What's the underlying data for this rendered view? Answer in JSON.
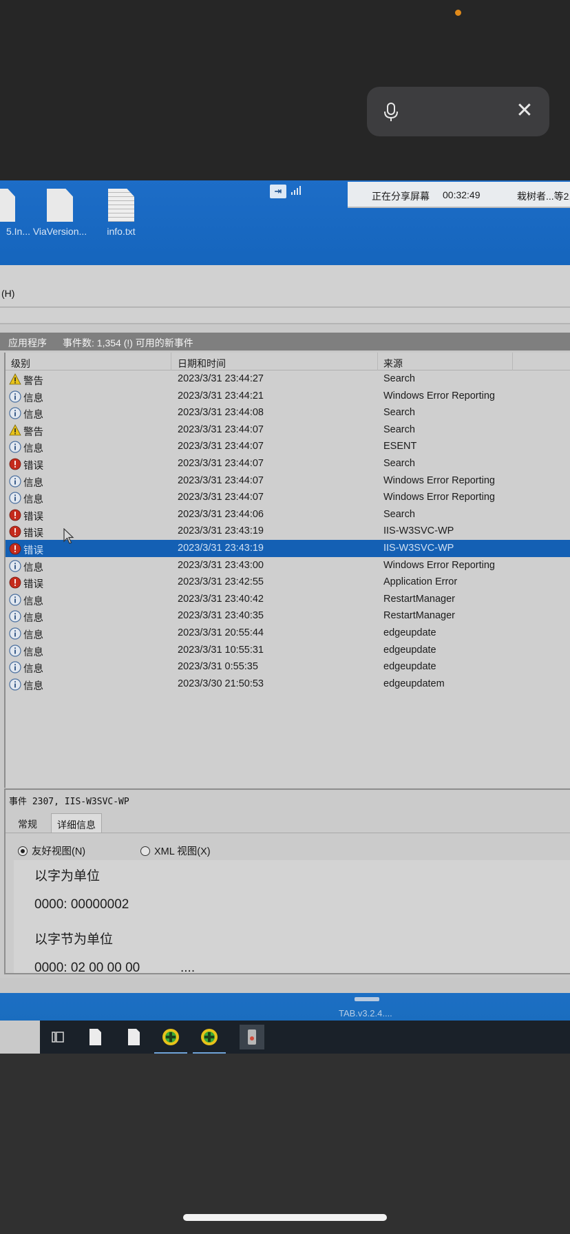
{
  "phone": {
    "mic_icon": "microphone-icon",
    "close_icon": "close-icon",
    "close_symbol": "✕"
  },
  "desktop": {
    "icons": [
      {
        "label": "5.In...",
        "icon": "file-icon"
      },
      {
        "label": "ViaVersion...",
        "icon": "file-icon"
      },
      {
        "label": "info.txt",
        "icon": "text-file-icon"
      }
    ],
    "share_status": "正在分享屏幕",
    "share_time": "00:32:49",
    "share_viewers": "栽树者...等2,",
    "pin_symbol": "⇥"
  },
  "menubar": {
    "help_label": "(H)"
  },
  "app": {
    "title": "应用程序",
    "summary": "事件数: 1,354 (!) 可用的新事件"
  },
  "grid": {
    "columns": [
      "级别",
      "日期和时间",
      "来源"
    ],
    "rows": [
      {
        "level": "警告",
        "type": "warning",
        "datetime": "2023/3/31 23:44:27",
        "source": "Search"
      },
      {
        "level": "信息",
        "type": "info",
        "datetime": "2023/3/31 23:44:21",
        "source": "Windows Error Reporting"
      },
      {
        "level": "信息",
        "type": "info",
        "datetime": "2023/3/31 23:44:08",
        "source": "Search"
      },
      {
        "level": "警告",
        "type": "warning",
        "datetime": "2023/3/31 23:44:07",
        "source": "Search"
      },
      {
        "level": "信息",
        "type": "info",
        "datetime": "2023/3/31 23:44:07",
        "source": "ESENT"
      },
      {
        "level": "错误",
        "type": "error",
        "datetime": "2023/3/31 23:44:07",
        "source": "Search"
      },
      {
        "level": "信息",
        "type": "info",
        "datetime": "2023/3/31 23:44:07",
        "source": "Windows Error Reporting"
      },
      {
        "level": "信息",
        "type": "info",
        "datetime": "2023/3/31 23:44:07",
        "source": "Windows Error Reporting"
      },
      {
        "level": "错误",
        "type": "error",
        "datetime": "2023/3/31 23:44:06",
        "source": "Search"
      },
      {
        "level": "错误",
        "type": "error",
        "datetime": "2023/3/31 23:43:19",
        "source": "IIS-W3SVC-WP"
      },
      {
        "level": "错误",
        "type": "error",
        "datetime": "2023/3/31 23:43:19",
        "source": "IIS-W3SVC-WP",
        "selected": true
      },
      {
        "level": "信息",
        "type": "info",
        "datetime": "2023/3/31 23:43:00",
        "source": "Windows Error Reporting"
      },
      {
        "level": "错误",
        "type": "error",
        "datetime": "2023/3/31 23:42:55",
        "source": "Application Error"
      },
      {
        "level": "信息",
        "type": "info",
        "datetime": "2023/3/31 23:40:42",
        "source": "RestartManager"
      },
      {
        "level": "信息",
        "type": "info",
        "datetime": "2023/3/31 23:40:35",
        "source": "RestartManager"
      },
      {
        "level": "信息",
        "type": "info",
        "datetime": "2023/3/31 20:55:44",
        "source": "edgeupdate"
      },
      {
        "level": "信息",
        "type": "info",
        "datetime": "2023/3/31 10:55:31",
        "source": "edgeupdate"
      },
      {
        "level": "信息",
        "type": "info",
        "datetime": "2023/3/31 0:55:35",
        "source": "edgeupdate"
      },
      {
        "level": "信息",
        "type": "info",
        "datetime": "2023/3/30 21:50:53",
        "source": "edgeupdatem"
      }
    ]
  },
  "detail": {
    "title": "事件 2307, IIS-W3SVC-WP",
    "tabs": [
      "常规",
      "详细信息"
    ],
    "active_tab": "详细信息",
    "view_options": [
      "友好视图(N)",
      "XML 视图(X)"
    ],
    "selected_view": "友好视图(N)",
    "lines": [
      "以字为单位",
      "0000: 00000002",
      "以字节为单位",
      "0000: 02 00 00 00",
      "...."
    ]
  },
  "bottom": {
    "tab_label": "TAB.v3.2.4...."
  },
  "taskbar": {
    "items": [
      "task-view-icon",
      "file-icon",
      "file-icon",
      "green-app-icon",
      "green-app-icon",
      "app-icon"
    ]
  },
  "colors": {
    "selection": "#1460b4",
    "desktop_blue": "#1565bd",
    "error_red": "#c42b1c",
    "warning_yellow": "#e8c31a",
    "info_blue": "#4a7cc0"
  }
}
